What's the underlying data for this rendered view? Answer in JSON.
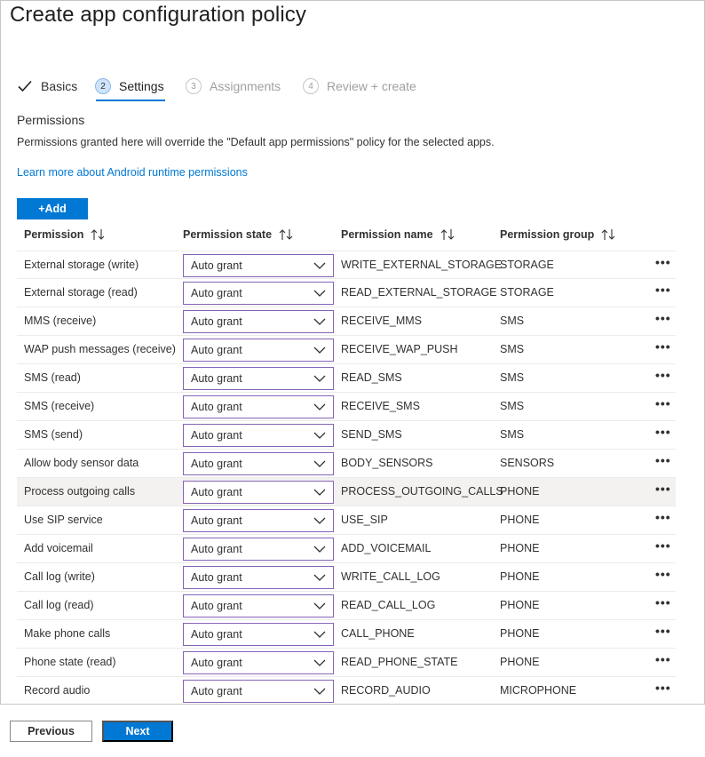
{
  "page": {
    "title": "Create app configuration policy"
  },
  "steps": [
    {
      "label": "Basics",
      "state": "done",
      "icon": "checkmark-icon"
    },
    {
      "num": "2",
      "label": "Settings",
      "state": "active"
    },
    {
      "num": "3",
      "label": "Assignments",
      "state": "disabled"
    },
    {
      "num": "4",
      "label": "Review + create",
      "state": "disabled"
    }
  ],
  "section": {
    "title": "Permissions",
    "description": "Permissions granted here will override the \"Default app permissions\" policy for the selected apps.",
    "link": "Learn more about Android runtime permissions"
  },
  "toolbar": {
    "add_label": "+Add"
  },
  "table": {
    "headers": [
      "Permission",
      "Permission state",
      "Permission name",
      "Permission group"
    ],
    "rows": [
      {
        "permission": "External storage (write)",
        "state": "Auto grant",
        "name": "WRITE_EXTERNAL_STORAGE",
        "group": "STORAGE"
      },
      {
        "permission": "External storage (read)",
        "state": "Auto grant",
        "name": "READ_EXTERNAL_STORAGE",
        "group": "STORAGE"
      },
      {
        "permission": "MMS (receive)",
        "state": "Auto grant",
        "name": "RECEIVE_MMS",
        "group": "SMS"
      },
      {
        "permission": "WAP push messages (receive)",
        "state": "Auto grant",
        "name": "RECEIVE_WAP_PUSH",
        "group": "SMS"
      },
      {
        "permission": "SMS (read)",
        "state": "Auto grant",
        "name": "READ_SMS",
        "group": "SMS"
      },
      {
        "permission": "SMS (receive)",
        "state": "Auto grant",
        "name": "RECEIVE_SMS",
        "group": "SMS"
      },
      {
        "permission": "SMS (send)",
        "state": "Auto grant",
        "name": "SEND_SMS",
        "group": "SMS"
      },
      {
        "permission": "Allow body sensor data",
        "state": "Auto grant",
        "name": "BODY_SENSORS",
        "group": "SENSORS"
      },
      {
        "permission": "Process outgoing calls",
        "state": "Auto grant",
        "name": "PROCESS_OUTGOING_CALLS",
        "group": "PHONE"
      },
      {
        "permission": "Use SIP service",
        "state": "Auto grant",
        "name": "USE_SIP",
        "group": "PHONE"
      },
      {
        "permission": "Add voicemail",
        "state": "Auto grant",
        "name": "ADD_VOICEMAIL",
        "group": "PHONE"
      },
      {
        "permission": "Call log (write)",
        "state": "Auto grant",
        "name": "WRITE_CALL_LOG",
        "group": "PHONE"
      },
      {
        "permission": "Call log (read)",
        "state": "Auto grant",
        "name": "READ_CALL_LOG",
        "group": "PHONE"
      },
      {
        "permission": "Make phone calls",
        "state": "Auto grant",
        "name": "CALL_PHONE",
        "group": "PHONE"
      },
      {
        "permission": "Phone state (read)",
        "state": "Auto grant",
        "name": "READ_PHONE_STATE",
        "group": "PHONE"
      },
      {
        "permission": "Record audio",
        "state": "Auto grant",
        "name": "RECORD_AUDIO",
        "group": "MICROPHONE"
      }
    ]
  },
  "footer": {
    "previous_label": "Previous",
    "next_label": "Next"
  },
  "colors": {
    "accent": "#0078d4",
    "select_border": "#8764b8",
    "row_highlight": "#f3f2f1"
  }
}
